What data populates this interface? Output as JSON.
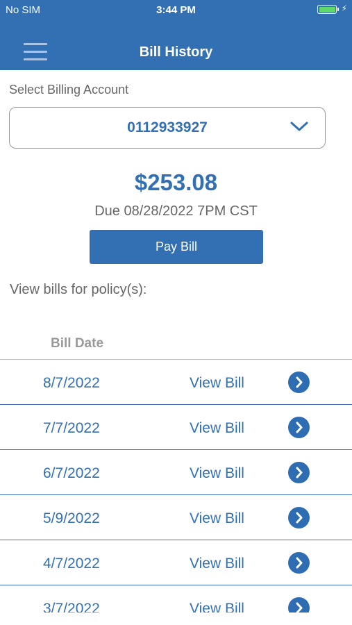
{
  "status_bar": {
    "carrier": "No SIM",
    "time": "3:44 PM"
  },
  "header": {
    "title": "Bill History",
    "menu_icon": "hamburger-menu-icon"
  },
  "account": {
    "label": "Select Billing Account",
    "selected": "0112933927",
    "dropdown_icon": "chevron-down-icon"
  },
  "summary": {
    "amount": "$253.08",
    "due": "Due 08/28/2022 7PM CST",
    "pay_label": "Pay Bill"
  },
  "policy_label": "View bills for policy(s):",
  "table": {
    "column_header": "Bill Date",
    "rows": [
      {
        "date": "8/7/2022",
        "action": "View Bill"
      },
      {
        "date": "7/7/2022",
        "action": "View Bill"
      },
      {
        "date": "6/7/2022",
        "action": "View Bill"
      },
      {
        "date": "5/9/2022",
        "action": "View Bill"
      },
      {
        "date": "4/7/2022",
        "action": "View Bill"
      },
      {
        "date": "3/7/2022",
        "action": "View Bill"
      }
    ],
    "row_icon": "chevron-right-circle-icon"
  },
  "colors": {
    "brand": "#3270b3",
    "battery": "#5fd86a"
  }
}
